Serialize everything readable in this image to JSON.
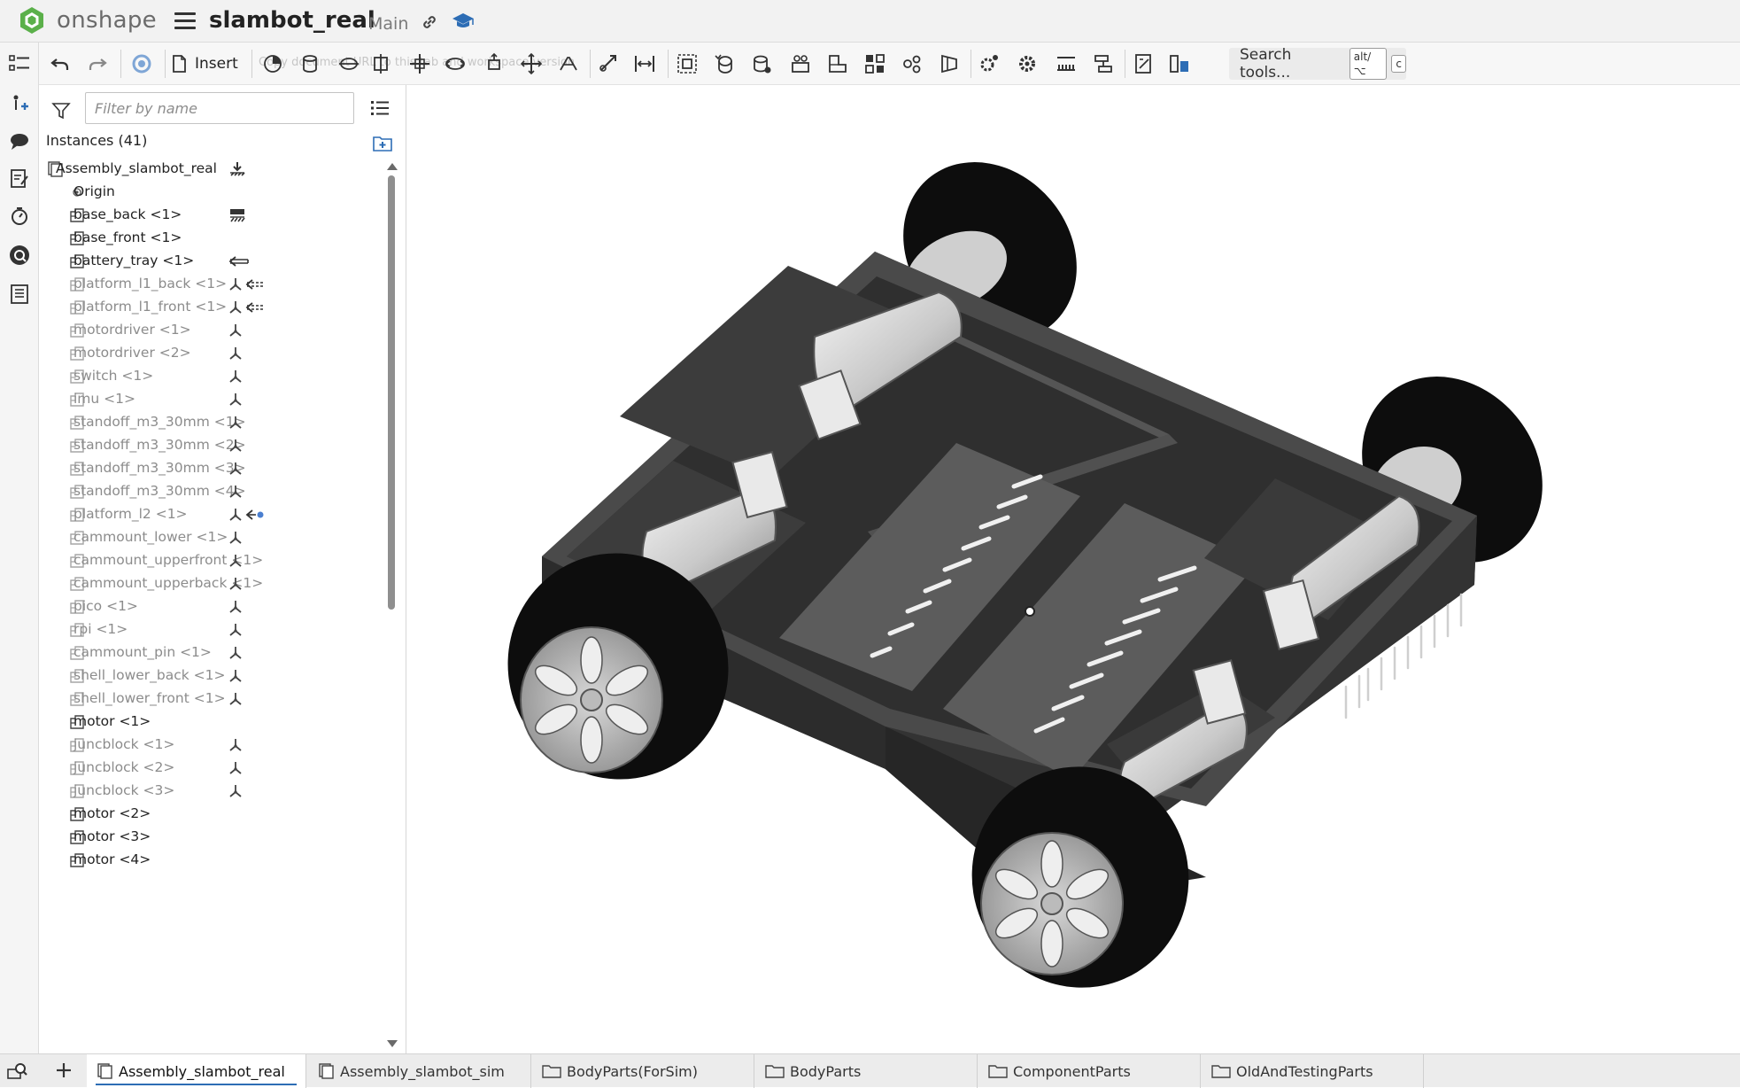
{
  "header": {
    "brand": "onshape",
    "document_title": "slambot_real",
    "branch": "Main"
  },
  "toolbar": {
    "insert_label": "Insert",
    "ghost_text": "Copy document URL to this tab and workspace version",
    "search_label": "Search tools...",
    "search_shortcut_1": "alt/⌥",
    "search_shortcut_2": "c"
  },
  "panel": {
    "filter_placeholder": "Filter by name",
    "instances_header": "Instances (41)",
    "root": "Assembly_slambot_real",
    "origin": "Origin",
    "items": [
      {
        "label": "base_back <1>",
        "muted": false,
        "marks": [
          "group"
        ]
      },
      {
        "label": "base_front <1>",
        "muted": false,
        "marks": []
      },
      {
        "label": "battery_tray <1>",
        "muted": false,
        "marks": [
          "arrow"
        ]
      },
      {
        "label": "platform_l1_back <1>",
        "muted": true,
        "marks": [
          "fixed",
          "arrow-dash"
        ]
      },
      {
        "label": "platform_l1_front <1>",
        "muted": true,
        "marks": [
          "fixed",
          "arrow-dash"
        ]
      },
      {
        "label": "motordriver <1>",
        "muted": true,
        "marks": [
          "fixed"
        ]
      },
      {
        "label": "motordriver <2>",
        "muted": true,
        "marks": [
          "fixed"
        ]
      },
      {
        "label": "switch <1>",
        "muted": true,
        "marks": [
          "fixed"
        ]
      },
      {
        "label": "imu <1>",
        "muted": true,
        "marks": [
          "fixed"
        ]
      },
      {
        "label": "standoff_m3_30mm <1>",
        "muted": true,
        "marks": [
          "fixed"
        ]
      },
      {
        "label": "standoff_m3_30mm <2>",
        "muted": true,
        "marks": [
          "fixed"
        ]
      },
      {
        "label": "standoff_m3_30mm <3>",
        "muted": true,
        "marks": [
          "fixed"
        ]
      },
      {
        "label": "standoff_m3_30mm <4>",
        "muted": true,
        "marks": [
          "fixed"
        ]
      },
      {
        "label": "platform_l2 <1>",
        "muted": true,
        "marks": [
          "fixed",
          "arrow-dot"
        ]
      },
      {
        "label": "cammount_lower <1>",
        "muted": true,
        "marks": [
          "fixed"
        ]
      },
      {
        "label": "cammount_upperfront <1>",
        "muted": true,
        "marks": [
          "fixed"
        ]
      },
      {
        "label": "cammount_upperback <1>",
        "muted": true,
        "marks": [
          "fixed"
        ]
      },
      {
        "label": "pico <1>",
        "muted": true,
        "marks": [
          "fixed"
        ]
      },
      {
        "label": "rpi <1>",
        "muted": true,
        "marks": [
          "fixed"
        ]
      },
      {
        "label": "cammount_pin <1>",
        "muted": true,
        "marks": [
          "fixed"
        ]
      },
      {
        "label": "shell_lower_back <1>",
        "muted": true,
        "marks": [
          "fixed"
        ]
      },
      {
        "label": "shell_lower_front <1>",
        "muted": true,
        "marks": [
          "fixed"
        ]
      },
      {
        "label": "motor <1>",
        "muted": false,
        "marks": []
      },
      {
        "label": "juncblock <1>",
        "muted": true,
        "marks": [
          "fixed"
        ]
      },
      {
        "label": "juncblock <2>",
        "muted": true,
        "marks": [
          "fixed"
        ]
      },
      {
        "label": "juncblock <3>",
        "muted": true,
        "marks": [
          "fixed"
        ]
      },
      {
        "label": "motor <2>",
        "muted": false,
        "marks": []
      },
      {
        "label": "motor <3>",
        "muted": false,
        "marks": []
      },
      {
        "label": "motor <4>",
        "muted": false,
        "marks": []
      }
    ]
  },
  "tabs": [
    {
      "label": "Assembly_slambot_real",
      "icon": "assembly-icon",
      "active": true
    },
    {
      "label": "Assembly_slambot_sim",
      "icon": "assembly-icon",
      "active": false
    },
    {
      "label": "BodyParts(ForSim)",
      "icon": "folder-icon",
      "active": false
    },
    {
      "label": "BodyParts",
      "icon": "folder-icon",
      "active": false
    },
    {
      "label": "ComponentParts",
      "icon": "folder-icon",
      "active": false
    },
    {
      "label": "OldAndTestingParts",
      "icon": "folder-icon",
      "active": false
    }
  ],
  "colors": {
    "brand_green": "#5bb04a",
    "accent_blue": "#2d6db5",
    "muted_text": "#8c8c8c",
    "dot_blue": "#4a7fd0"
  }
}
